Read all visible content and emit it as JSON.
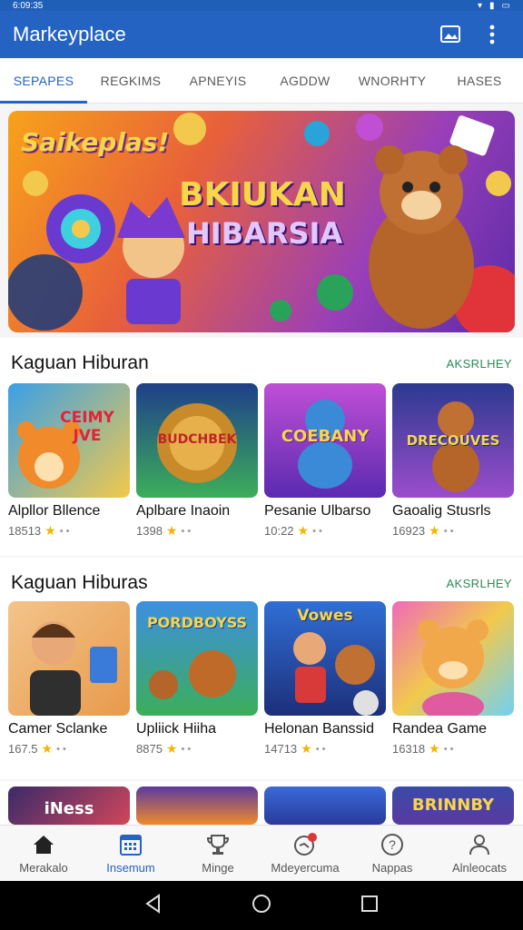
{
  "status_bar": {
    "time": "6:09:35"
  },
  "app_bar": {
    "title": "Markeyplace"
  },
  "tabs": [
    {
      "label": "SEPAPES",
      "active": true
    },
    {
      "label": "REGKIMS",
      "active": false
    },
    {
      "label": "APNEYIS",
      "active": false
    },
    {
      "label": "AGDDW",
      "active": false
    },
    {
      "label": "WNORHTY",
      "active": false
    },
    {
      "label": "HASES",
      "active": false
    }
  ],
  "banner": {
    "brand": "Saikeplas!",
    "headline_1": "BKIUKAN",
    "headline_2": "HIBARSIA"
  },
  "sections": [
    {
      "title": "Kaguan Hiburan",
      "link": "AKSRLHEY",
      "cards": [
        {
          "title": "Alpllor Bllence",
          "rating": "18513",
          "thumb_text": "CEIMY JVE",
          "colors": [
            "#3aa0e8",
            "#f2c94c"
          ]
        },
        {
          "title": "Aplbare Inaoin",
          "rating": "1398",
          "thumb_text": "BUDCHBEK",
          "colors": [
            "#1e3f8a",
            "#3cae5a"
          ]
        },
        {
          "title": "Pesanie Ulbarso",
          "rating": "10:22",
          "thumb_text": "COEBANY",
          "colors": [
            "#c04fd6",
            "#5a2ab0"
          ]
        },
        {
          "title": "Gaoalig Stusrls",
          "rating": "16923",
          "thumb_text": "DRECOUVES",
          "colors": [
            "#2b3a8f",
            "#9c4dcc"
          ]
        }
      ]
    },
    {
      "title": "Kaguan Hiburas",
      "link": "AKSRLHEY",
      "cards": [
        {
          "title": "Camer Sclanke",
          "rating": "167.5",
          "thumb_text": "",
          "colors": [
            "#f3c48a",
            "#e79a4c"
          ]
        },
        {
          "title": "Upliick Hiiha",
          "rating": "8875",
          "thumb_text": "PORDBOYSS",
          "colors": [
            "#3d8fe0",
            "#3cae5a"
          ]
        },
        {
          "title": "Helonan Banssid",
          "rating": "14713",
          "thumb_text": "Vowes",
          "colors": [
            "#2f6fd6",
            "#1d2f7a"
          ]
        },
        {
          "title": "Randea Game",
          "rating": "16318",
          "thumb_text": "",
          "colors": [
            "#f06ab8",
            "#6fd1f5"
          ]
        }
      ]
    }
  ],
  "partial_row": [
    {
      "thumb_text": "iNess",
      "colors": [
        "#3a2a6a",
        "#d0465a"
      ]
    },
    {
      "thumb_text": "",
      "colors": [
        "#5a3aa0",
        "#f08a2a"
      ]
    },
    {
      "thumb_text": "",
      "colors": [
        "#3a6ad8",
        "#2a3a9a"
      ]
    },
    {
      "thumb_text": "BRINNBY",
      "colors": [
        "#3a4aa8",
        "#f2c94c"
      ]
    }
  ],
  "bottom_nav": [
    {
      "label": "Merakalo",
      "icon": "home-icon",
      "active": false
    },
    {
      "label": "Insemum",
      "icon": "calendar-icon",
      "active": true
    },
    {
      "label": "Minge",
      "icon": "trophy-icon",
      "active": false
    },
    {
      "label": "Mdeyercuma",
      "icon": "badge-icon",
      "active": false
    },
    {
      "label": "Nappas",
      "icon": "help-icon",
      "active": false
    },
    {
      "label": "Alnleocats",
      "icon": "person-icon",
      "active": false
    }
  ],
  "colors": {
    "primary": "#2563c2",
    "link": "#2a8a55",
    "star": "#f4b400"
  }
}
